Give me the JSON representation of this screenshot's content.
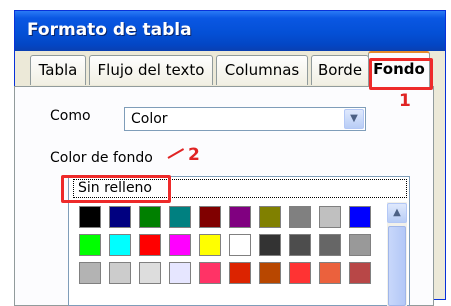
{
  "dialog": {
    "title": "Formato de tabla"
  },
  "tabs": [
    {
      "label": "Tabla"
    },
    {
      "label": "Flujo del texto"
    },
    {
      "label": "Columnas"
    },
    {
      "label": "Borde"
    },
    {
      "label": "Fondo",
      "active": true
    }
  ],
  "como": {
    "label": "Como",
    "value": "Color"
  },
  "color_de_fondo": {
    "label": "Color de fondo",
    "no_fill": "Sin relleno",
    "palette": [
      [
        "#000000",
        "#000080",
        "#008000",
        "#008080",
        "#800000",
        "#800080",
        "#808000",
        "#808080",
        "#c0c0c0",
        "#0000ff"
      ],
      [
        "#00ff00",
        "#00ffff",
        "#ff0000",
        "#ff00ff",
        "#ffff00",
        "#ffffff",
        "#333333",
        "#4d4d4d",
        "#666666",
        "#999999"
      ],
      [
        "#b3b3b3",
        "#cccccc",
        "#dddddd",
        "#e6e6ff",
        "#ff3366",
        "#dc2300",
        "#b84700",
        "#ff3333",
        "#eb613d",
        "#b84747"
      ]
    ]
  },
  "annotations": [
    {
      "number": "1",
      "color": "#e02424"
    },
    {
      "number": "2",
      "color": "#e02424"
    }
  ]
}
